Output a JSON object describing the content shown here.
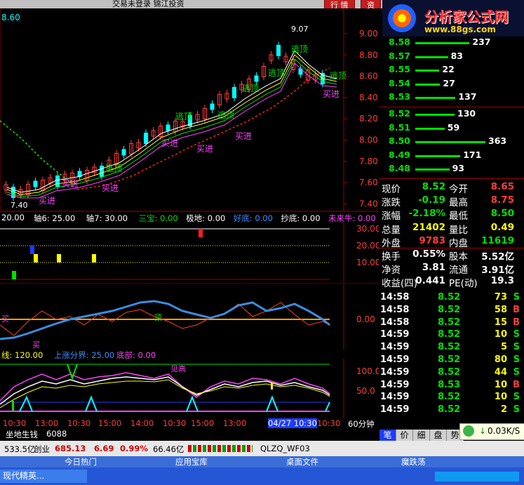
{
  "window": {
    "title": "交易未登录 锦江投资",
    "buttons": [
      "行 情",
      "资"
    ]
  },
  "banner": {
    "name": "分析家公式网",
    "url": "www.88gs.com"
  },
  "main_chart": {
    "top_left_price": "8.60",
    "high_marker": "9.07",
    "low_marker": "7.40",
    "y_ticks": [
      "9.00",
      "8.80",
      "8.60",
      "8.40",
      "8.20",
      "8.00",
      "7.80",
      "7.60",
      "7.40"
    ],
    "annotations": {
      "buy": "买进",
      "top": "逃顶"
    }
  },
  "indicator1": {
    "header": [
      {
        "text": "20.00",
        "color": "#ffffff"
      },
      {
        "text": "轴6: 25.00",
        "color": "#ffffff"
      },
      {
        "text": "轴7: 30.00",
        "color": "#ffffff"
      },
      {
        "text": "三宝: 0.00",
        "color": "#00e000"
      },
      {
        "text": "极地: 0.00",
        "color": "#ffffff"
      },
      {
        "text": "好底: 0.00",
        "color": "#3c8cff"
      },
      {
        "text": "抄底: 0.00",
        "color": "#ffffff"
      },
      {
        "text": "未来牛: 0.00",
        "color": "#ff40ff"
      }
    ],
    "y_ticks": [
      "30.00",
      "20.00",
      "10.00"
    ]
  },
  "indicator2": {
    "y_ticks": [
      "0.00"
    ],
    "labels": {
      "buy": "买",
      "top": "顶"
    }
  },
  "indicator3": {
    "header": [
      {
        "text": "线: 120.00",
        "color": "#ffff00"
      },
      {
        "text": "上涨分界: 25.00",
        "color": "#3c8cff"
      },
      {
        "text": "底部: 0.00",
        "color": "#ff40ff"
      }
    ],
    "y_ticks": [
      "100.0",
      "50.0"
    ],
    "label": "见高"
  },
  "x_axis": {
    "labels": [
      "10:30",
      "13:00",
      "10:30",
      "15:00",
      "14:00",
      "10:30",
      "15:00",
      "13:00",
      "04/27 10:30",
      "10:30"
    ],
    "period": "60分钟"
  },
  "bottom_strip": {
    "name": "坐地生钱",
    "value": "6088"
  },
  "orderbook": {
    "asks": [
      {
        "price": "8.58",
        "vol": "237",
        "pr_color": "#00e000"
      },
      {
        "price": "8.57",
        "vol": "83",
        "pr_color": "#00e000"
      },
      {
        "price": "8.55",
        "vol": "22",
        "pr_color": "#00e000"
      },
      {
        "price": "8.54",
        "vol": "27",
        "pr_color": "#00e000"
      },
      {
        "price": "8.53",
        "vol": "137",
        "pr_color": "#00e000"
      }
    ],
    "bids": [
      {
        "price": "8.52",
        "vol": "130",
        "pr_color": "#00e000"
      },
      {
        "price": "8.51",
        "vol": "59",
        "pr_color": "#00e000"
      },
      {
        "price": "8.50",
        "vol": "363",
        "pr_color": "#00e000"
      },
      {
        "price": "8.49",
        "vol": "171",
        "pr_color": "#00e000"
      },
      {
        "price": "8.48",
        "vol": "93",
        "pr_color": "#00e000"
      }
    ]
  },
  "quote": [
    {
      "l1": "现价",
      "v1": "8.52",
      "c1": "#00e000",
      "l2": "今开",
      "v2": "8.65",
      "c2": "#ff3c3c"
    },
    {
      "l1": "涨跌",
      "v1": "-0.19",
      "c1": "#00e000",
      "l2": "最高",
      "v2": "8.75",
      "c2": "#ff3c3c"
    },
    {
      "l1": "涨幅",
      "v1": "-2.18%",
      "c1": "#00e000",
      "l2": "最低",
      "v2": "8.50",
      "c2": "#00e000"
    },
    {
      "l1": "总量",
      "v1": "21402",
      "c1": "#ffff00",
      "l2": "量比",
      "v2": "0.49",
      "c2": "#ffff00"
    },
    {
      "l1": "外盘",
      "v1": "9783",
      "c1": "#ff3c3c",
      "l2": "内盘",
      "v2": "11619",
      "c2": "#00e000"
    },
    {
      "l1": "换手",
      "v1": "0.55%",
      "c1": "#ffffff",
      "l2": "股本",
      "v2": "5.52亿",
      "c2": "#ffffff"
    },
    {
      "l1": "净资",
      "v1": "3.81",
      "c1": "#ffffff",
      "l2": "流通",
      "v2": "3.91亿",
      "c2": "#ffffff"
    },
    {
      "l1": "收益(四)",
      "v1": "0.441",
      "c1": "#ffffff",
      "l2": "PE(动)",
      "v2": "19.3",
      "c2": "#ffffff"
    }
  ],
  "ticks": [
    {
      "time": "14:58",
      "price": "8.52",
      "vol": "73",
      "side": "S"
    },
    {
      "time": "14:58",
      "price": "8.52",
      "vol": "58",
      "side": "B"
    },
    {
      "time": "14:58",
      "price": "8.52",
      "vol": "15",
      "side": "B"
    },
    {
      "time": "14:59",
      "price": "8.52",
      "vol": "10",
      "side": "S"
    },
    {
      "time": "14:59",
      "price": "8.52",
      "vol": "5",
      "side": "S"
    },
    {
      "time": "14:59",
      "price": "8.52",
      "vol": "80",
      "side": "S"
    },
    {
      "time": "14:59",
      "price": "8.52",
      "vol": "44",
      "side": "S"
    },
    {
      "time": "14:59",
      "price": "8.53",
      "vol": "10",
      "side": "B"
    },
    {
      "time": "14:59",
      "price": "8.52",
      "vol": "10",
      "side": "S"
    },
    {
      "time": "14:59",
      "price": "8.52",
      "vol": "2",
      "side": "S"
    }
  ],
  "panel_tabs": [
    "笔",
    "价",
    "细",
    "盘",
    "势"
  ],
  "speed": "0.03K/S",
  "statusbar": {
    "t1": "533.5亿",
    "t2": "创业",
    "t3": "685.13",
    "t4": "6.69",
    "t5": "0.99%",
    "t6": "66.46亿",
    "t7": "QLZQ_WF03"
  },
  "bottombar": [
    "今日热门",
    "应用宝库",
    "桌面文件",
    "魔跌荡"
  ],
  "taskbar": {
    "item": "现代精英..."
  }
}
